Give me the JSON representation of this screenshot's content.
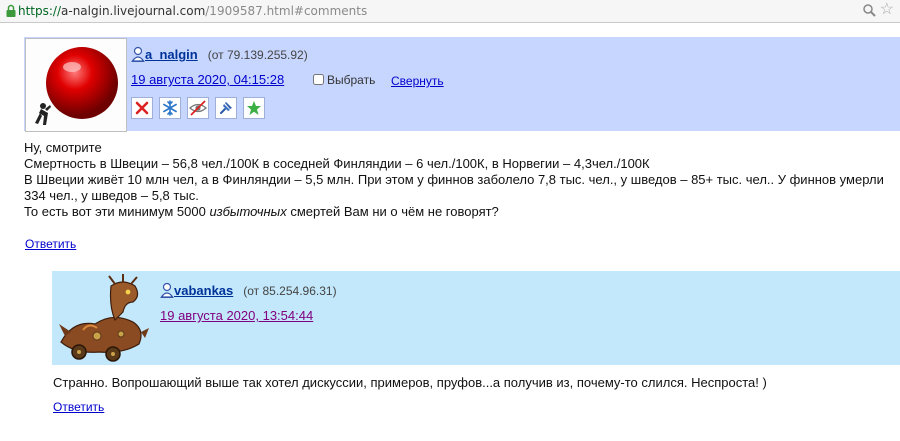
{
  "browser": {
    "url_scheme": "https://",
    "url_domain": "a-nalgin.livejournal.com",
    "url_path": "/1909587.html#comments",
    "lock_icon": "lock-icon",
    "zoom_icon": "zoom-icon",
    "star_icon": "bookmark-star-icon"
  },
  "comments": [
    {
      "username": "a_nalgin",
      "ip": "(от 79.139.255.92)",
      "date": "19 августа 2020, 04:15:28",
      "select_label": "Выбрать",
      "collapse_label": "Свернуть",
      "actions": [
        "delete-icon",
        "freeze-icon",
        "hide-icon",
        "track-icon",
        "star-icon"
      ],
      "lines": [
        "Ну, смотрите",
        "Смертность в Швеции – 56,8 чел./100К в соседней Финляндии – 6 чел./100К, в Норвегии – 4,3чел./100К",
        "В Швеции живёт 10 млн чел, а в Финляндии – 5,5 млн. При этом у финнов заболело 7,8 тыс. чел., у шведов – 85+ тыс. чел.. У финнов умерли",
        "334  чел., у шведов – 5,8 тыс."
      ],
      "last_line_before": "То есть вот эти минимум 5000 ",
      "last_line_em": "избыточных",
      "last_line_after": " смертей Вам ни о чём не говорят?",
      "reply_label": "Ответить",
      "header_color": "#c7d6ff"
    },
    {
      "username": "vabankas",
      "ip": "(от 85.254.96.31)",
      "date": "19 августа 2020, 13:54:44",
      "text": "Странно. Вопрошающий выше так хотел дискуссии, примеров, пруфов...а получив из, почему-то слился. Неспроста! )",
      "reply_label": "Ответить",
      "header_color": "#c3e8fb"
    }
  ]
}
